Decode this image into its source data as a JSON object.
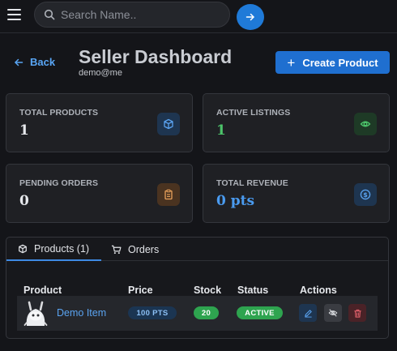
{
  "search": {
    "placeholder": "Search Name.."
  },
  "header": {
    "back_label": "Back",
    "title": "Seller Dashboard",
    "subtitle": "demo@me",
    "create_label": "Create Product"
  },
  "stats": [
    {
      "label": "TOTAL PRODUCTS",
      "value": "1",
      "value_color": "#e6e8ec",
      "icon": "cube-icon"
    },
    {
      "label": "ACTIVE LISTINGS",
      "value": "1",
      "value_color": "#4cc46a",
      "icon": "eye-icon"
    },
    {
      "label": "PENDING ORDERS",
      "value": "0",
      "value_color": "#e6e8ec",
      "icon": "clipboard-icon"
    },
    {
      "label": "TOTAL REVENUE",
      "value": "0 pts",
      "value_color": "#4a9bf0",
      "icon": "dollar-icon"
    }
  ],
  "tabs": [
    {
      "label": "Products (1)",
      "active": true,
      "icon": "cube-icon"
    },
    {
      "label": "Orders",
      "active": false,
      "icon": "cart-icon"
    }
  ],
  "table": {
    "columns": [
      "Product",
      "Price",
      "Stock",
      "Status",
      "Actions"
    ],
    "rows": [
      {
        "name": "Demo Item",
        "price": "100 PTS",
        "stock": "20",
        "status": "ACTIVE"
      }
    ]
  },
  "colors": {
    "accent": "#1f6fd0",
    "link": "#59a6f5",
    "success": "#2ea44f"
  }
}
